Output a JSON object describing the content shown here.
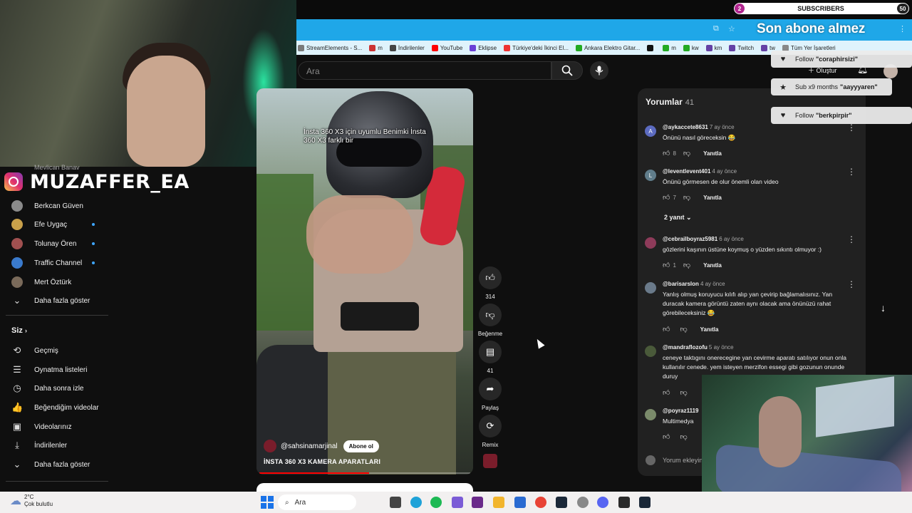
{
  "overlay": {
    "subs_label": "SUBSCRIBERS",
    "subs_start": "2",
    "subs_goal": "50",
    "goal_text": "Son abone almez",
    "instagram_name": "MUZAFFER_EA",
    "alerts": [
      {
        "prefix": "Follow",
        "name": "\"coraphirsizi\"",
        "icon": "heart-icon"
      },
      {
        "prefix": "Sub x9 months",
        "name": "\"aayyyaren\"",
        "icon": "star-icon"
      },
      {
        "prefix": "Follow",
        "name": "\"berkpirpir\"",
        "icon": "heart-icon"
      }
    ]
  },
  "bookmarks": [
    {
      "label": "StreamElements - S...",
      "color": "#7a7a7a"
    },
    {
      "label": "m",
      "color": "#c33"
    },
    {
      "label": "İndirilenler",
      "color": "#444"
    },
    {
      "label": "YouTube",
      "color": "#f00"
    },
    {
      "label": "Eklipse",
      "color": "#6a3fd6"
    },
    {
      "label": "Türkiye'deki İkinci El...",
      "color": "#e33"
    },
    {
      "label": "Ankara Elektro Gitar...",
      "color": "#2a2"
    },
    {
      "label": "",
      "color": "#111"
    },
    {
      "label": "m",
      "color": "#2a2"
    },
    {
      "label": "kw",
      "color": "#2a2"
    },
    {
      "label": "km",
      "color": "#6441a5"
    },
    {
      "label": "Twitch",
      "color": "#6441a5"
    },
    {
      "label": "tw",
      "color": "#6441a5"
    },
    {
      "label": "Tüm Yer İşaretleri",
      "color": "#888"
    }
  ],
  "header": {
    "search_placeholder": "Ara",
    "create_label": "Oluştur"
  },
  "sidebar": {
    "cut_item": "Mevlican Banav",
    "subscriptions": [
      {
        "label": "Berkcan Güven",
        "color": "#8a8a8a",
        "live": false
      },
      {
        "label": "Efe Uygaç",
        "color": "#c8a04a",
        "live": true
      },
      {
        "label": "Tolunay Ören",
        "color": "#a05050",
        "live": true
      },
      {
        "label": "Traffic Channel",
        "color": "#3a7acc",
        "live": true
      },
      {
        "label": "Mert Öztürk",
        "color": "#7a6a5a",
        "live": false
      }
    ],
    "show_more_1": "Daha fazla göster",
    "you_label": "Siz",
    "you_items": [
      {
        "label": "Geçmiş",
        "icon": "history-icon",
        "glyph": "⟲"
      },
      {
        "label": "Oynatma listeleri",
        "icon": "playlists-icon",
        "glyph": "☰"
      },
      {
        "label": "Daha sonra izle",
        "icon": "clock-icon",
        "glyph": "◷"
      },
      {
        "label": "Beğendiğim videolar",
        "icon": "like-icon",
        "glyph": "👍"
      },
      {
        "label": "Videolarınız",
        "icon": "videos-icon",
        "glyph": "▣"
      },
      {
        "label": "İndirilenler",
        "icon": "download-icon",
        "glyph": "⤓"
      }
    ],
    "show_more_2": "Daha fazla göster"
  },
  "video": {
    "caption": "İnsta 360 X3 için uyumlu Benimki İnsta 360 X3 farklı bir",
    "channel": "@sahsinamarjinal",
    "subscribe_label": "Abone ol",
    "title": "İNSTA 360 X3 KAMERA APARATLARI",
    "progress": 0.52
  },
  "actions": {
    "likes": "314",
    "dislike_label": "Beğenme",
    "comments": "41",
    "share_label": "Paylaş",
    "remix_label": "Remix"
  },
  "comments": {
    "title": "Yorumlar",
    "count": "41",
    "replies_toggle": "2 yanıt",
    "input_placeholder": "Yorum ekleyin...",
    "reply_label": "Yanıtla",
    "items": [
      {
        "handle": "@aykaccete8631",
        "time": "7 ay önce",
        "text": "Önünü nasıl göreceksin 😂",
        "likes": "8",
        "avatar_letter": "A",
        "avatar_color": "#5c6bc0"
      },
      {
        "handle": "@leventlevent401",
        "time": "4 ay önce",
        "text": "Önünü görmesen de olur önemli olan video",
        "likes": "7",
        "avatar_letter": "L",
        "avatar_color": "#607d8b"
      },
      {
        "handle": "@cebrailboyraz5981",
        "time": "6 ay önce",
        "text": "gözlerini kaşının üstüne koymuş o yüzden sıkıntı olmuyor :)",
        "likes": "1",
        "avatar_letter": "",
        "avatar_color": "#8e3b5a"
      },
      {
        "handle": "@barisarslon",
        "time": "4 ay önce",
        "text": "Yanlış olmuş koruyucu kılıfı alıp yan çevirip bağlamalısınız. Yan duracak kamera görüntü zaten aynı olacak ama önünüzü rahat görebileceksiniz 😂",
        "likes": "",
        "avatar_letter": "",
        "avatar_color": "#6a7a8a"
      },
      {
        "handle": "@mandraflozofu",
        "time": "5 ay önce",
        "text": "ceneye taktıgını onerecegine yan cevirme aparatı satılıyor onun onla kullanılır cenede. yem isteyen merzifon essegi gibi gozunun onunde duruy",
        "likes": "",
        "avatar_letter": "",
        "avatar_color": "#4a5a3a"
      },
      {
        "handle": "@poyraz1119",
        "time": "",
        "text": "Multimedya",
        "likes": "",
        "avatar_letter": "",
        "avatar_color": "#7a8a6a"
      }
    ]
  },
  "taskbar": {
    "weather_temp": "2°C",
    "weather_desc": "Çok bulutlu",
    "search_label": "Ara"
  }
}
